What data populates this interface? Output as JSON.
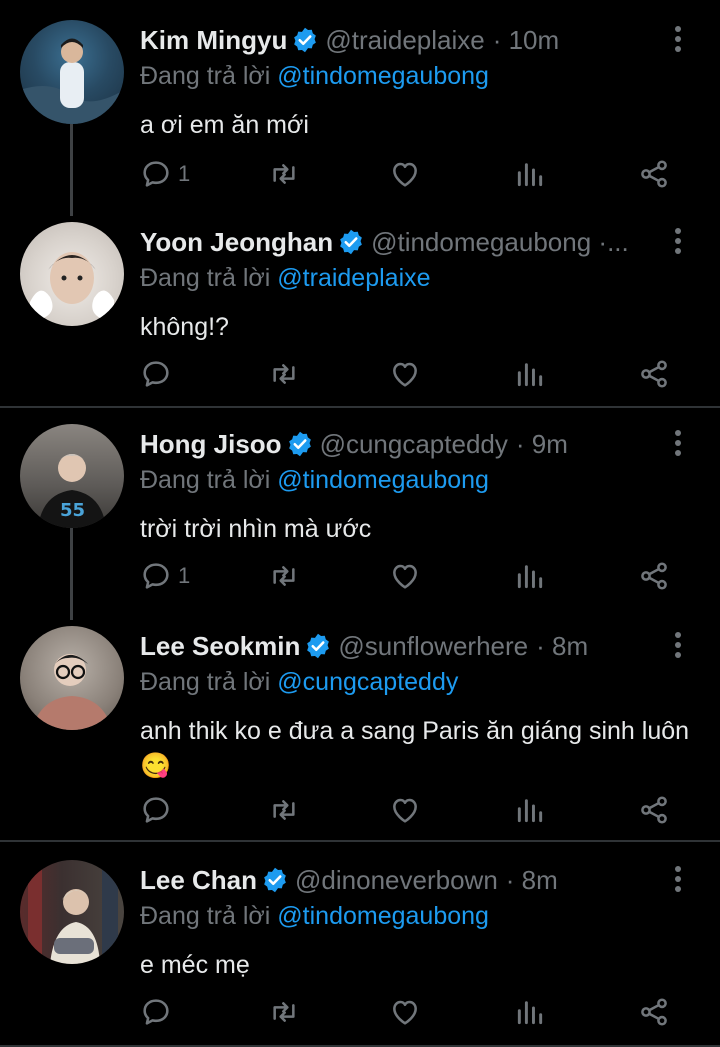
{
  "colors": {
    "background": "#000000",
    "link": "#1d9bf0",
    "muted": "#71767b",
    "verified": "#1d9bf0"
  },
  "replying_prefix": "Đang trả lời",
  "tweets": [
    {
      "name": "Kim Mingyu",
      "handle": "@traideplaixe",
      "time": "· 10m",
      "reply_to": "@tindomegaubong",
      "text": "a ơi em ăn mới",
      "reply_count": "1"
    },
    {
      "name": "Yoon Jeonghan",
      "handle": "@tindomegaubong ·...",
      "time": "",
      "reply_to": "@traideplaixe",
      "text": "không!?",
      "reply_count": ""
    },
    {
      "name": "Hong Jisoo",
      "handle": "@cungcapteddy",
      "time": "· 9m",
      "reply_to": "@tindomegaubong",
      "text": "trời trời nhìn mà ước",
      "reply_count": "1"
    },
    {
      "name": "Lee Seokmin",
      "handle": "@sunflowerhere",
      "time": "· 8m",
      "reply_to": "@cungcapteddy",
      "text": "anh thik ko e đưa a sang Paris ăn giáng sinh luôn 😋",
      "reply_count": ""
    },
    {
      "name": "Lee Chan",
      "handle": "@dinoneverbown",
      "time": "· 8m",
      "reply_to": "@tindomegaubong",
      "text": "e méc mẹ",
      "reply_count": ""
    }
  ]
}
